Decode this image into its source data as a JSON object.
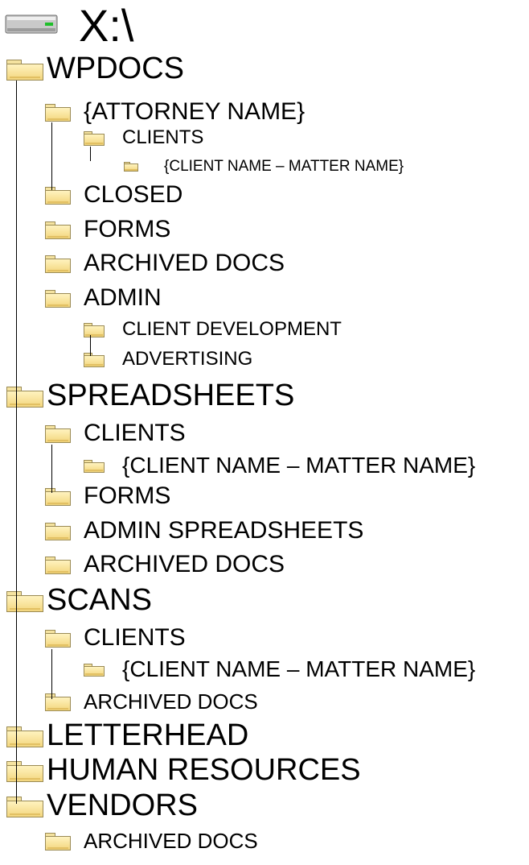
{
  "root": {
    "label": "X:\\",
    "icon": "drive-icon"
  },
  "folder_color": "#f7df8f",
  "nodes": [
    {
      "label": "WPDOCS",
      "level": 0
    },
    {
      "label": "{ATTORNEY NAME}",
      "level": 1
    },
    {
      "label": "CLIENTS",
      "level": 2
    },
    {
      "label": "{CLIENT NAME – MATTER NAME}",
      "level": 3
    },
    {
      "label": "CLOSED",
      "level": 1
    },
    {
      "label": "FORMS",
      "level": 1
    },
    {
      "label": "ARCHIVED DOCS",
      "level": 1
    },
    {
      "label": "ADMIN",
      "level": 1
    },
    {
      "label": "CLIENT DEVELOPMENT",
      "level": 2
    },
    {
      "label": "ADVERTISING",
      "level": 2
    },
    {
      "label": "SPREADSHEETS",
      "level": 0
    },
    {
      "label": "CLIENTS",
      "level": 1
    },
    {
      "label": "{CLIENT NAME – MATTER NAME}",
      "level": 2
    },
    {
      "label": "FORMS",
      "level": 1
    },
    {
      "label": "ADMIN SPREADSHEETS",
      "level": 1
    },
    {
      "label": "ARCHIVED DOCS",
      "level": 1
    },
    {
      "label": "SCANS",
      "level": 0
    },
    {
      "label": "CLIENTS",
      "level": 1
    },
    {
      "label": "{CLIENT NAME – MATTER NAME}",
      "level": 2
    },
    {
      "label": "ARCHIVED DOCS",
      "level": 1
    },
    {
      "label": "LETTERHEAD",
      "level": 0
    },
    {
      "label": "HUMAN RESOURCES",
      "level": 0
    },
    {
      "label": "VENDORS",
      "level": 0
    },
    {
      "label": "ARCHIVED DOCS",
      "level": 1
    }
  ]
}
